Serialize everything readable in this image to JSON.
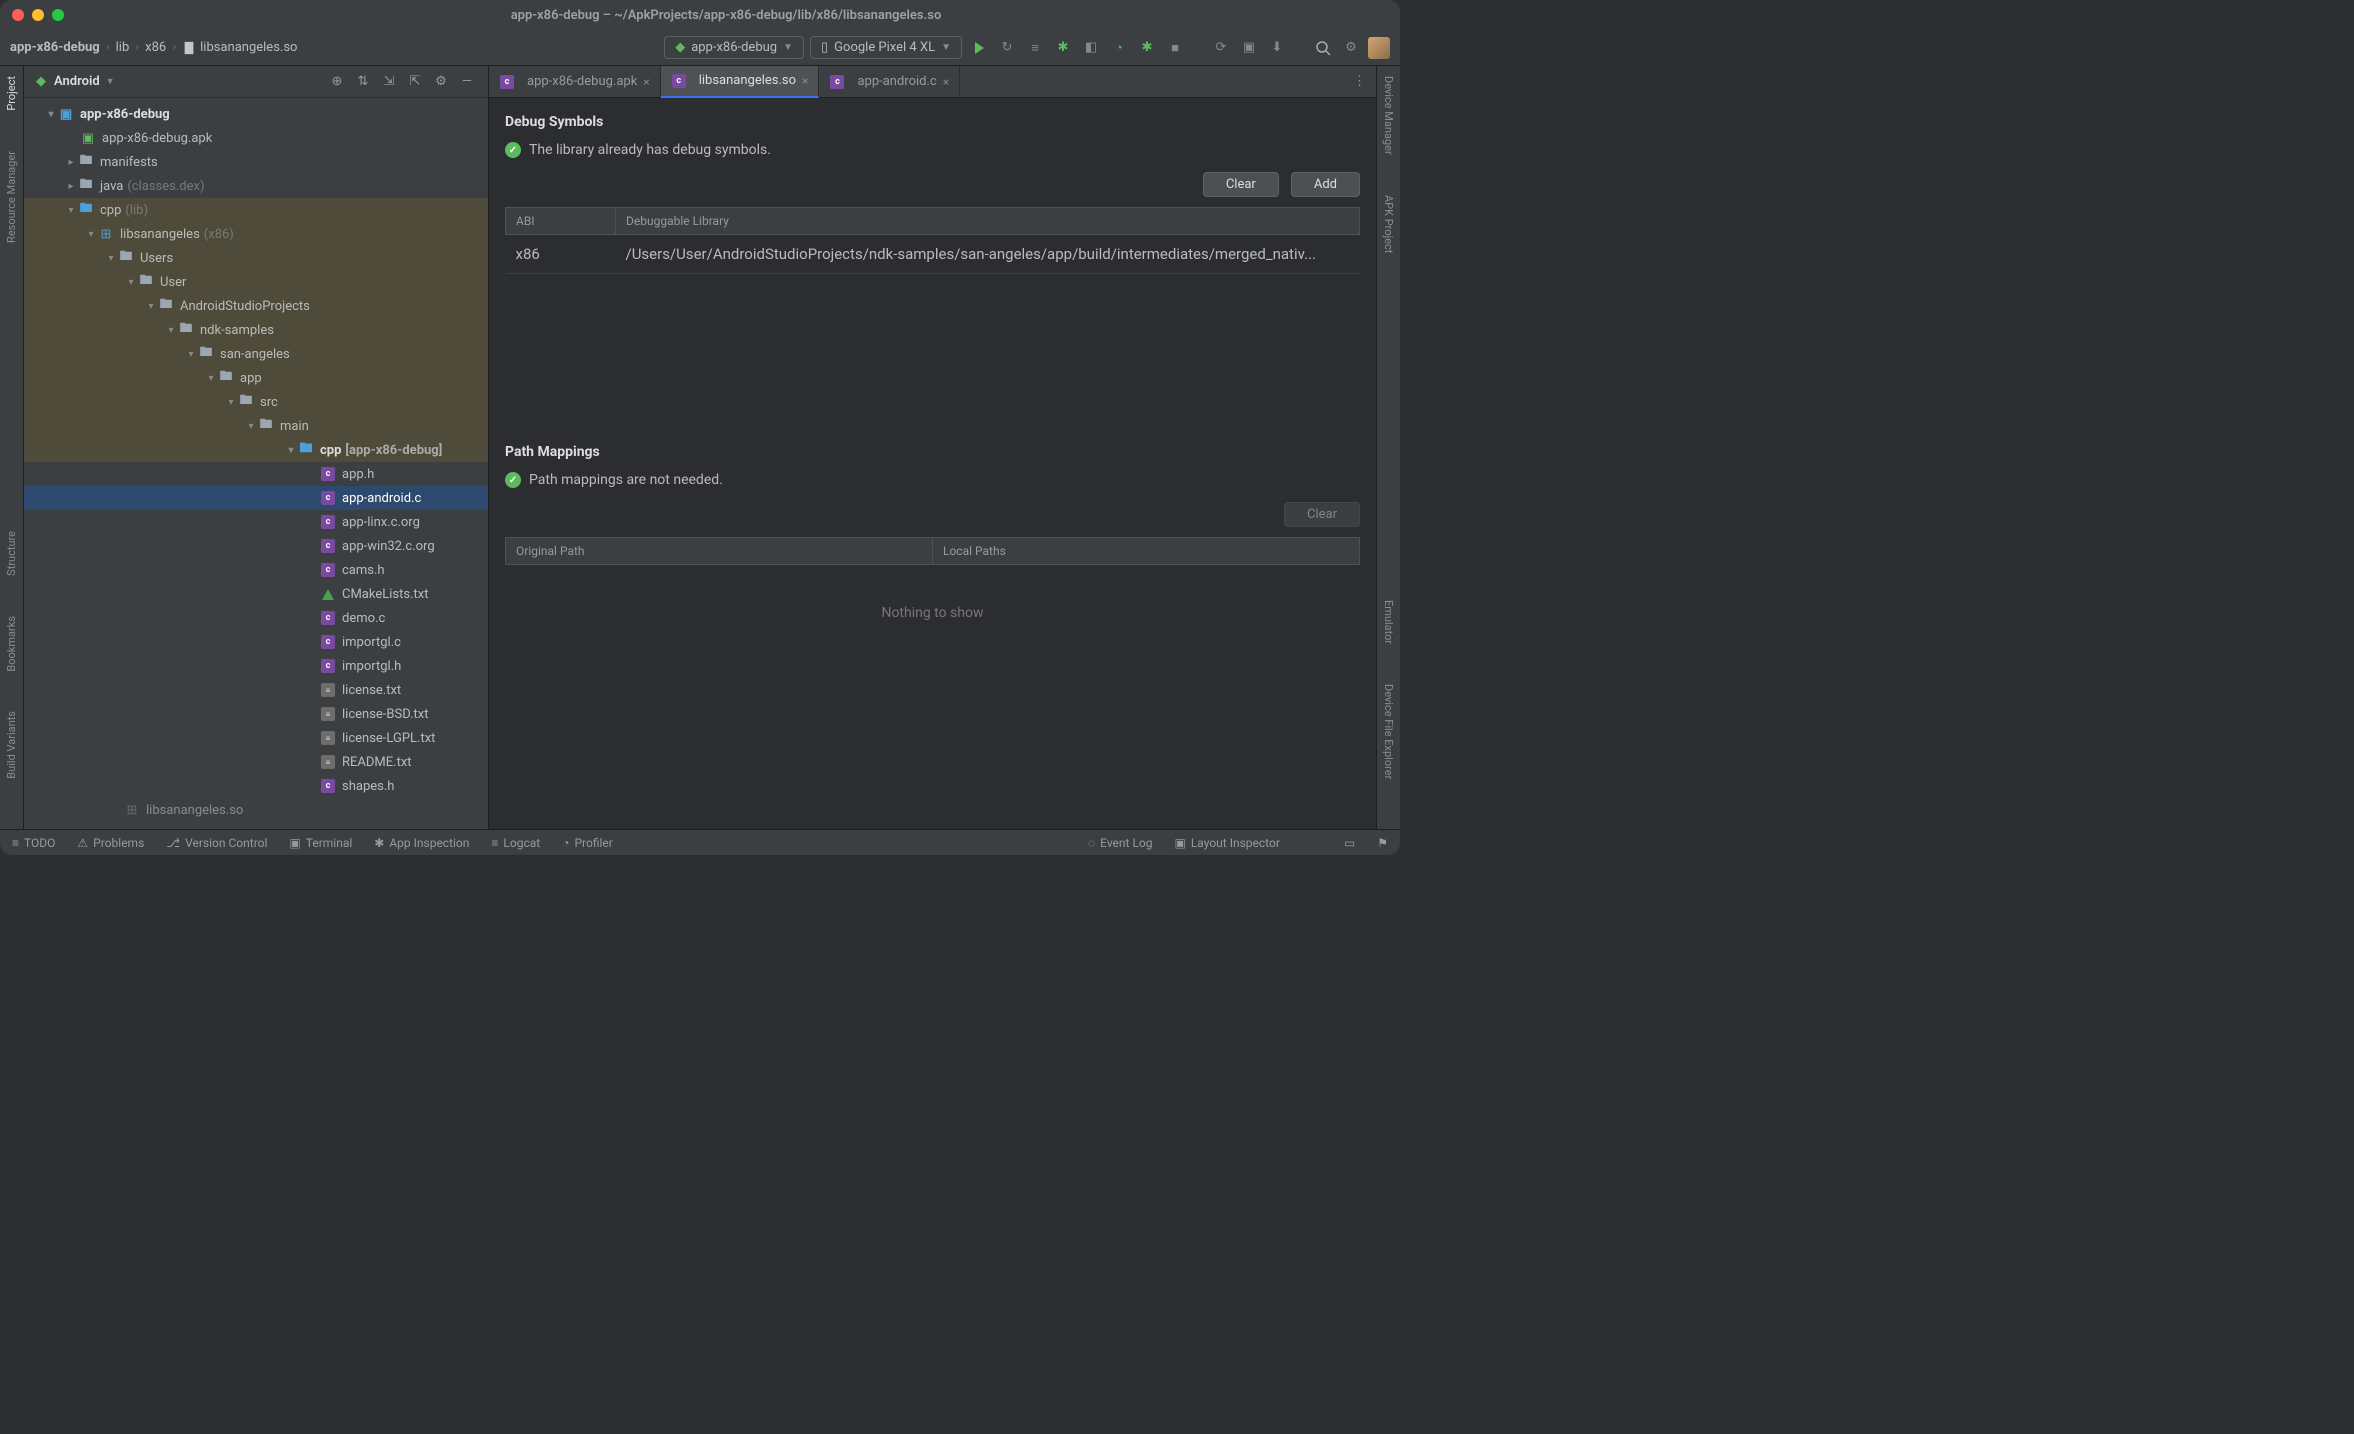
{
  "title": "app-x86-debug – ~/ApkProjects/app-x86-debug/lib/x86/libsanangeles.so",
  "breadcrumbs": [
    "app-x86-debug",
    "lib",
    "x86",
    "libsanangeles.so"
  ],
  "run_config": "app-x86-debug",
  "device_config": "Google Pixel 4 XL",
  "panel": {
    "title": "Android"
  },
  "tree": {
    "root": "app-x86-debug",
    "apk": "app-x86-debug.apk",
    "manifests": "manifests",
    "java": "java",
    "java_note": "(classes.dex)",
    "cpp": "cpp",
    "cpp_note": "(lib)",
    "lib_name": "libsanangeles",
    "lib_arch": "(x86)",
    "path": [
      "Users",
      "User",
      "AndroidStudioProjects",
      "ndk-samples",
      "san-angeles",
      "app",
      "src",
      "main"
    ],
    "cpp_module": "cpp",
    "cpp_module_note": "[app-x86-debug]",
    "files": [
      "app.h",
      "app-android.c",
      "app-linx.c.org",
      "app-win32.c.org",
      "cams.h",
      "CMakeLists.txt",
      "demo.c",
      "importgl.c",
      "importgl.h",
      "license.txt",
      "license-BSD.txt",
      "license-LGPL.txt",
      "README.txt",
      "shapes.h"
    ],
    "trailing": "libsanangeles.so"
  },
  "tabs": [
    {
      "label": "app-x86-debug.apk",
      "active": false
    },
    {
      "label": "libsanangeles.so",
      "active": true
    },
    {
      "label": "app-android.c",
      "active": false
    }
  ],
  "debug_symbols": {
    "title": "Debug Symbols",
    "status": "The library already has debug symbols.",
    "buttons": {
      "clear": "Clear",
      "add": "Add"
    },
    "columns": {
      "abi": "ABI",
      "lib": "Debuggable Library"
    },
    "rows": [
      {
        "abi": "x86",
        "lib": "/Users/User/AndroidStudioProjects/ndk-samples/san-angeles/app/build/intermediates/merged_nativ..."
      }
    ]
  },
  "path_mappings": {
    "title": "Path Mappings",
    "status": "Path mappings are not needed.",
    "buttons": {
      "clear": "Clear"
    },
    "columns": {
      "orig": "Original Path",
      "local": "Local Paths"
    },
    "empty": "Nothing to show"
  },
  "left_gutter": [
    "Project",
    "Resource Manager",
    "Structure",
    "Bookmarks",
    "Build Variants"
  ],
  "right_gutter": [
    "Device Manager",
    "APK Project",
    "Emulator",
    "Device File Explorer"
  ],
  "bottom": {
    "todo": "TODO",
    "problems": "Problems",
    "vcs": "Version Control",
    "terminal": "Terminal",
    "app_inspection": "App Inspection",
    "logcat": "Logcat",
    "profiler": "Profiler",
    "event_log": "Event Log",
    "layout_inspector": "Layout Inspector"
  }
}
